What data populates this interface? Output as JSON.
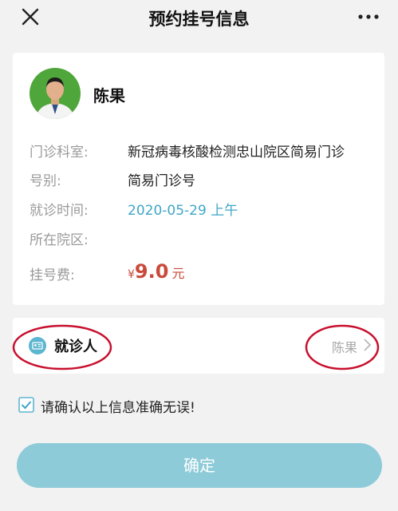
{
  "navbar": {
    "title": "预约挂号信息",
    "close_icon": "close-icon",
    "more_icon": "more-icon"
  },
  "doctor": {
    "name": "陈果",
    "rows": [
      {
        "label": "门诊科室:",
        "value": "新冠病毒核酸检测忠山院区简易门诊"
      },
      {
        "label": "号别:",
        "value": "简易门诊号"
      },
      {
        "label": "就诊时间:",
        "value": "2020-05-29 上午"
      },
      {
        "label": "所在院区:",
        "value": ""
      },
      {
        "label": "挂号费:",
        "currency": "¥",
        "amount": "9.0",
        "unit": "元"
      }
    ]
  },
  "patient": {
    "label": "就诊人",
    "value": "陈果"
  },
  "confirm": {
    "text": "请确认以上信息准确无误!",
    "checked": true
  },
  "submit": {
    "label": "确定"
  },
  "colors": {
    "accent": "#3fa6c7",
    "button": "#8ecbd8",
    "fee": "#c94a3b",
    "annotation": "#c8102e"
  }
}
